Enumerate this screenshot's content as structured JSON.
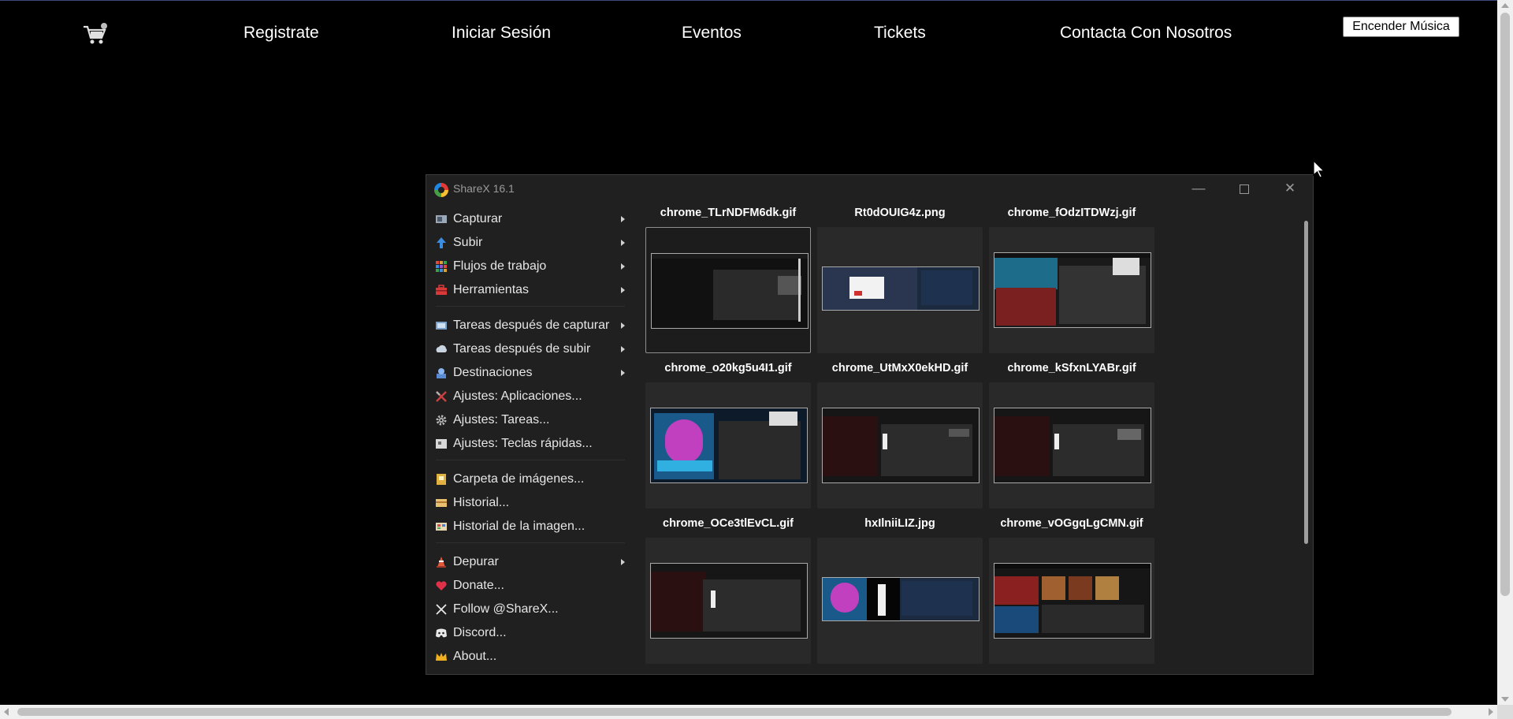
{
  "site": {
    "nav": {
      "registrate": "Registrate",
      "iniciar_sesion": "Iniciar Sesión",
      "eventos": "Eventos",
      "tickets": "Tickets",
      "contacta": "Contacta Con Nosotros"
    },
    "music_button": "Encender Música",
    "icons": [
      "cart-icon"
    ]
  },
  "sharex": {
    "title": "ShareX 16.1",
    "window_buttons": {
      "minimize": "—",
      "maximize": "",
      "close": "✕"
    },
    "menu": [
      {
        "label": "Capturar",
        "icon": "capture-icon",
        "submenu": true
      },
      {
        "label": "Subir",
        "icon": "upload-arrow-icon",
        "submenu": true
      },
      {
        "label": "Flujos de trabajo",
        "icon": "workflows-grid-icon",
        "submenu": true
      },
      {
        "label": "Herramientas",
        "icon": "toolbox-icon",
        "submenu": true
      },
      {
        "label": "Tareas después de capturar",
        "icon": "after-capture-icon",
        "submenu": true
      },
      {
        "label": "Tareas después de subir",
        "icon": "after-upload-icon",
        "submenu": true
      },
      {
        "label": "Destinaciones",
        "icon": "destinations-icon",
        "submenu": true
      },
      {
        "label": "Ajustes: Aplicaciones...",
        "icon": "app-settings-icon",
        "submenu": false
      },
      {
        "label": "Ajustes: Tareas...",
        "icon": "gear-icon",
        "submenu": false
      },
      {
        "label": "Ajustes: Teclas rápidas...",
        "icon": "hotkeys-icon",
        "submenu": false
      },
      {
        "label": "Carpeta de imágenes...",
        "icon": "folder-icon",
        "submenu": false
      },
      {
        "label": "Historial...",
        "icon": "history-icon",
        "submenu": false
      },
      {
        "label": "Historial de la imagen...",
        "icon": "image-history-icon",
        "submenu": false
      },
      {
        "label": "Depurar",
        "icon": "debug-cone-icon",
        "submenu": true
      },
      {
        "label": "Donate...",
        "icon": "heart-icon",
        "submenu": false
      },
      {
        "label": "Follow @ShareX...",
        "icon": "x-logo-icon",
        "submenu": false
      },
      {
        "label": "Discord...",
        "icon": "discord-icon",
        "submenu": false
      },
      {
        "label": "About...",
        "icon": "crown-icon",
        "submenu": false
      }
    ],
    "thumbnails": [
      {
        "name": "chrome_TLrNDFM6dk.gif",
        "selected": true
      },
      {
        "name": "Rt0dOUIG4z.png",
        "selected": false
      },
      {
        "name": "chrome_fOdzITDWzj.gif",
        "selected": false
      },
      {
        "name": "chrome_o20kg5u4I1.gif",
        "selected": false
      },
      {
        "name": "chrome_UtMxX0ekHD.gif",
        "selected": false
      },
      {
        "name": "chrome_kSfxnLYABr.gif",
        "selected": false
      },
      {
        "name": "chrome_OCe3tlEvCL.gif",
        "selected": false
      },
      {
        "name": "hxIlniiLIZ.jpg",
        "selected": false
      },
      {
        "name": "chrome_vOGgqLgCMN.gif",
        "selected": false
      }
    ]
  }
}
